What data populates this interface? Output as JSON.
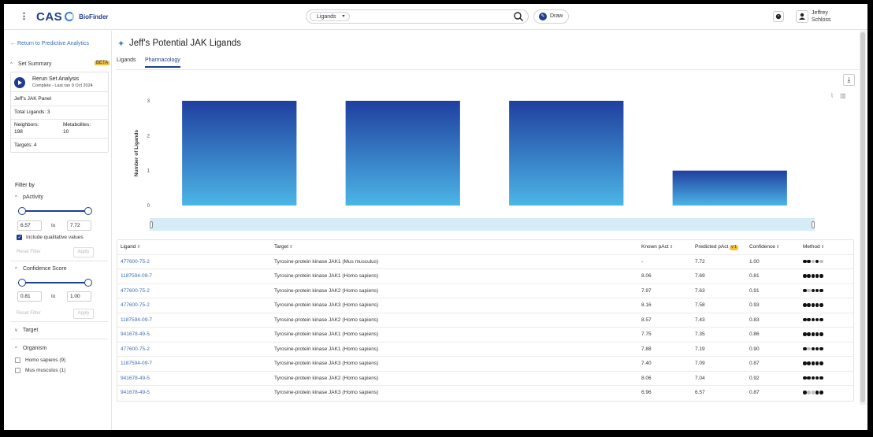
{
  "topbar": {
    "menu_icon": "kebab-icon",
    "logo_text": "CAS",
    "logo_product": "BioFinder",
    "search_type": "Ligands",
    "draw_label": "Draw",
    "user_name_first": "Jeffrey",
    "user_name_last": "Schloss"
  },
  "sidebar": {
    "back_link": "← Return to Predictive Analytics",
    "set_summary": "Set Summary",
    "beta": "BETA",
    "rerun_title": "Rerun Set Analysis",
    "rerun_status": "Complete - Last ran 9 Oct 2024",
    "panel_name": "Jeff's JAK Panel",
    "total_ligands": "Total Ligands: 3",
    "neighbors_label": "Neighbors:",
    "neighbors_value": "198",
    "metabolites_label": "Metabolites:",
    "metabolites_value": "10",
    "targets": "Targets: 4",
    "filter_by": "Filter by",
    "pactivity": {
      "label": "pActivity",
      "min": "6.57",
      "max": "7.72",
      "to": "to",
      "qualitative": "Include qualitative values",
      "qualitative_checked": true,
      "reset": "Reset Filter",
      "apply": "Apply"
    },
    "confidence": {
      "label": "Confidence Score",
      "min": "0.81",
      "max": "1.00",
      "to": "to",
      "reset": "Reset Filter",
      "apply": "Apply"
    },
    "target_label": "Target",
    "organism": {
      "label": "Organism",
      "options": [
        "Homo sapiens (9)",
        "Mus musculus (1)"
      ]
    }
  },
  "main": {
    "title": "Jeff's Potential JAK Ligands",
    "tabs": [
      "Ligands",
      "Pharmacology"
    ],
    "active_tab": "Pharmacology"
  },
  "chart_data": {
    "type": "bar",
    "categories": [
      "",
      "",
      "",
      ""
    ],
    "values": [
      3,
      3,
      3,
      1
    ],
    "ylabel": "Number of Ligands",
    "xlabel": "",
    "ylim": [
      0,
      3
    ],
    "yticks": [
      "0",
      "1",
      "2",
      "3"
    ],
    "colors": {
      "top": "#1f3f9f",
      "bottom": "#4cb5e6"
    }
  },
  "table": {
    "headers": [
      "Ligand",
      "Target",
      "Known pAct",
      "Predicted pAct",
      "Confidence",
      "Method"
    ],
    "predicted_badge": "v 1",
    "rows": [
      {
        "ligand": "477600-75-2",
        "target": "Tyrosine-protein kinase JAK1 (Mus musculus)",
        "known": "-",
        "predicted": "7.72",
        "confidence": "1.00",
        "method": [
          1,
          1,
          0,
          1,
          0
        ]
      },
      {
        "ligand": "1187594-09-7",
        "target": "Tyrosine-protein kinase JAK1 (Homo sapiens)",
        "known": "8.06",
        "predicted": "7.69",
        "confidence": "0.81",
        "method": [
          1,
          1,
          1,
          1,
          1
        ]
      },
      {
        "ligand": "477600-75-2",
        "target": "Tyrosine-protein kinase JAK2 (Homo sapiens)",
        "known": "7.97",
        "predicted": "7.63",
        "confidence": "0.91",
        "method": [
          1,
          0,
          1,
          1,
          1
        ]
      },
      {
        "ligand": "477600-75-2",
        "target": "Tyrosine-protein kinase JAK3 (Homo sapiens)",
        "known": "8.16",
        "predicted": "7.58",
        "confidence": "0.93",
        "method": [
          1,
          1,
          1,
          1,
          1
        ]
      },
      {
        "ligand": "1187594-09-7",
        "target": "Tyrosine-protein kinase JAK2 (Homo sapiens)",
        "known": "8.57",
        "predicted": "7.43",
        "confidence": "0.83",
        "method": [
          1,
          1,
          1,
          1,
          1
        ]
      },
      {
        "ligand": "941678-49-5",
        "target": "Tyrosine-protein kinase JAK1 (Homo sapiens)",
        "known": "7.75",
        "predicted": "7.35",
        "confidence": "0.86",
        "method": [
          1,
          1,
          1,
          1,
          1
        ]
      },
      {
        "ligand": "477600-75-2",
        "target": "Tyrosine-protein kinase JAK1 (Homo sapiens)",
        "known": "7.88",
        "predicted": "7.19",
        "confidence": "0.90",
        "method": [
          1,
          0,
          1,
          1,
          1
        ]
      },
      {
        "ligand": "1187594-09-7",
        "target": "Tyrosine-protein kinase JAK3 (Homo sapiens)",
        "known": "7.40",
        "predicted": "7.09",
        "confidence": "0.87",
        "method": [
          1,
          1,
          1,
          1,
          1
        ]
      },
      {
        "ligand": "941678-49-5",
        "target": "Tyrosine-protein kinase JAK2 (Homo sapiens)",
        "known": "8.06",
        "predicted": "7.04",
        "confidence": "0.92",
        "method": [
          1,
          1,
          1,
          1,
          1
        ]
      },
      {
        "ligand": "941678-49-5",
        "target": "Tyrosine-protein kinase JAK3 (Homo sapiens)",
        "known": "6.96",
        "predicted": "6.57",
        "confidence": "0.87",
        "method": [
          1,
          0,
          0,
          1,
          1
        ]
      }
    ]
  }
}
